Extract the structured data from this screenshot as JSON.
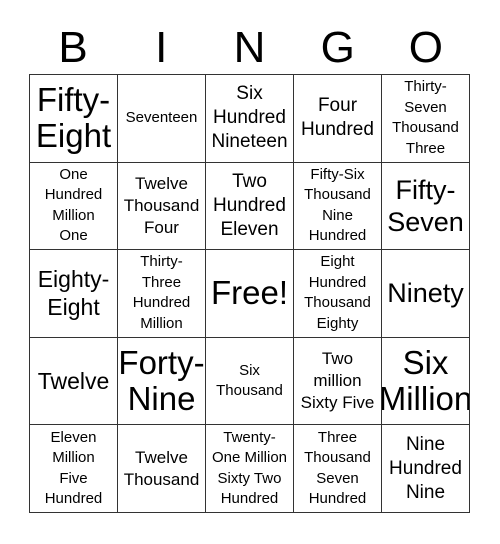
{
  "header": [
    "B",
    "I",
    "N",
    "G",
    "O"
  ],
  "cells": [
    {
      "text": "Fifty-\nEight",
      "size": "s6"
    },
    {
      "text": "Seventeen",
      "size": "s1"
    },
    {
      "text": "Six\nHundred\nNineteen",
      "size": "s3"
    },
    {
      "text": "Four\nHundred",
      "size": "s3"
    },
    {
      "text": "Thirty-\nSeven\nThousand\nThree",
      "size": "s1"
    },
    {
      "text": "One\nHundred\nMillion\nOne",
      "size": "s1"
    },
    {
      "text": "Twelve\nThousand\nFour",
      "size": "s2"
    },
    {
      "text": "Two\nHundred\nEleven",
      "size": "s3"
    },
    {
      "text": "Fifty-Six\nThousand\nNine\nHundred",
      "size": "s1"
    },
    {
      "text": "Fifty-\nSeven",
      "size": "s5"
    },
    {
      "text": "Eighty-\nEight",
      "size": "s4"
    },
    {
      "text": "Thirty-\nThree\nHundred\nMillion",
      "size": "s1"
    },
    {
      "text": "Free!",
      "size": "s6"
    },
    {
      "text": "Eight\nHundred\nThousand\nEighty",
      "size": "s1"
    },
    {
      "text": "Ninety",
      "size": "s5"
    },
    {
      "text": "Twelve",
      "size": "s4"
    },
    {
      "text": "Forty-\nNine",
      "size": "s6"
    },
    {
      "text": "Six\nThousand",
      "size": "s1"
    },
    {
      "text": "Two\nmillion\nSixty Five",
      "size": "s2"
    },
    {
      "text": "Six\nMillion",
      "size": "s6"
    },
    {
      "text": "Eleven\nMillion\nFive\nHundred",
      "size": "s1"
    },
    {
      "text": "Twelve\nThousand",
      "size": "s2"
    },
    {
      "text": "Twenty-\nOne Million\nSixty Two\nHundred",
      "size": "s1"
    },
    {
      "text": "Three\nThousand\nSeven\nHundred",
      "size": "s1"
    },
    {
      "text": "Nine\nHundred\nNine",
      "size": "s3"
    }
  ]
}
